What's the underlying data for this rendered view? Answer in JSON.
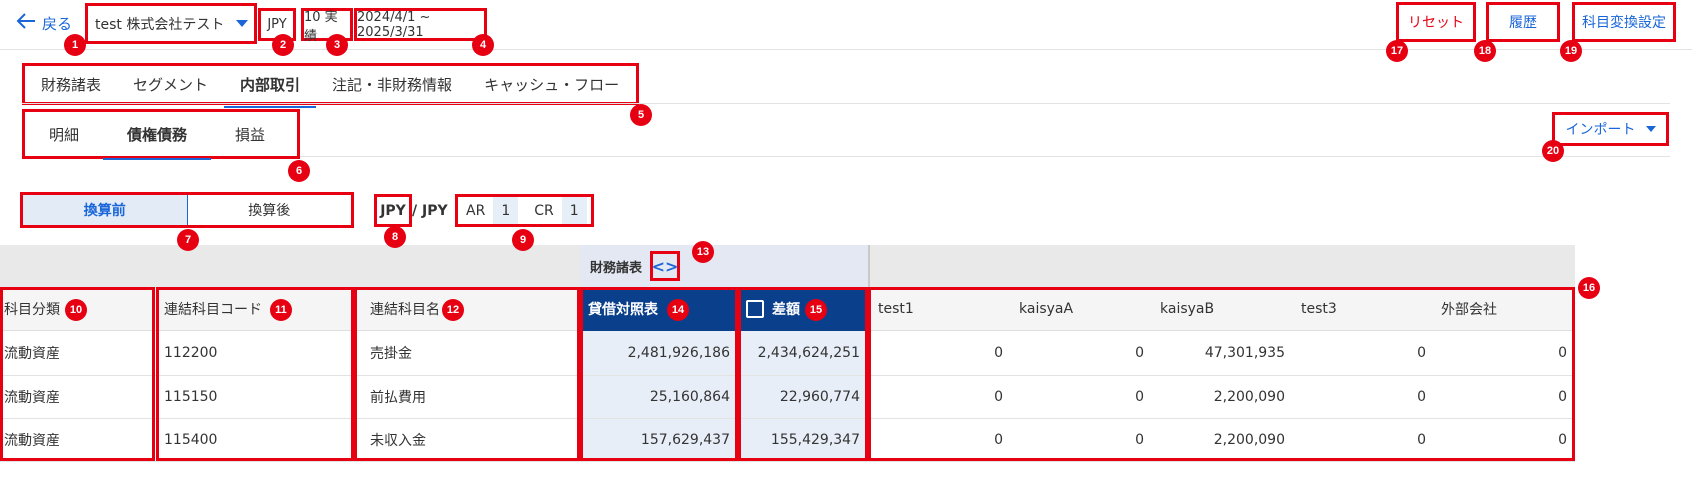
{
  "header": {
    "back_label": "戻る",
    "company": "test 株式会社テスト",
    "currency": "JPY",
    "scenario": "10 実績",
    "period": "2024/4/1 ~ 2025/3/31",
    "reset_label": "リセット",
    "history_label": "履歴",
    "account_mapping_label": "科目変換設定"
  },
  "tabs": [
    "財務諸表",
    "セグメント",
    "内部取引",
    "注記・非財務情報",
    "キャッシュ・フロー"
  ],
  "subtabs": [
    "明細",
    "債権債務",
    "損益"
  ],
  "import_label": "インポート",
  "conversion": {
    "before": "換算前",
    "after": "換算後"
  },
  "currency_pair": {
    "from": "JPY",
    "to": "/ JPY"
  },
  "rates": {
    "ar_label": "AR",
    "ar_value": "1",
    "cr_label": "CR",
    "cr_value": "1"
  },
  "table": {
    "group_header": "財務諸表",
    "columns": {
      "category": "科目分類",
      "code": "連結科目コード",
      "name": "連結科目名",
      "bs": "貸借対照表",
      "diff": "差額",
      "partners": [
        "test1",
        "kaisyaA",
        "kaisyaB",
        "test3",
        "外部会社"
      ]
    },
    "rows": [
      {
        "category": "流動資産",
        "code": "112200",
        "name": "売掛金",
        "bs": "2,481,926,186",
        "diff": "2,434,624,251",
        "partners": [
          "0",
          "0",
          "47,301,935",
          "0",
          "0"
        ]
      },
      {
        "category": "流動資産",
        "code": "115150",
        "name": "前払費用",
        "bs": "25,160,864",
        "diff": "22,960,774",
        "partners": [
          "0",
          "0",
          "2,200,090",
          "0",
          "0"
        ]
      },
      {
        "category": "流動資産",
        "code": "115400",
        "name": "未収入金",
        "bs": "157,629,437",
        "diff": "155,429,347",
        "partners": [
          "0",
          "0",
          "2,200,090",
          "0",
          "0"
        ]
      }
    ]
  },
  "badges": [
    "1",
    "2",
    "3",
    "4",
    "5",
    "6",
    "7",
    "8",
    "9",
    "10",
    "11",
    "12",
    "13",
    "14",
    "15",
    "16",
    "17",
    "18",
    "19",
    "20"
  ],
  "colors": {
    "accent": "#1a66d8",
    "annotation": "#e60012",
    "header_dark": "#0a3f8c"
  },
  "icons": {
    "back": "arrow-left-icon",
    "dropdown": "caret-down-icon",
    "expand": "code-brackets-icon",
    "checkbox": "checkbox-icon"
  }
}
